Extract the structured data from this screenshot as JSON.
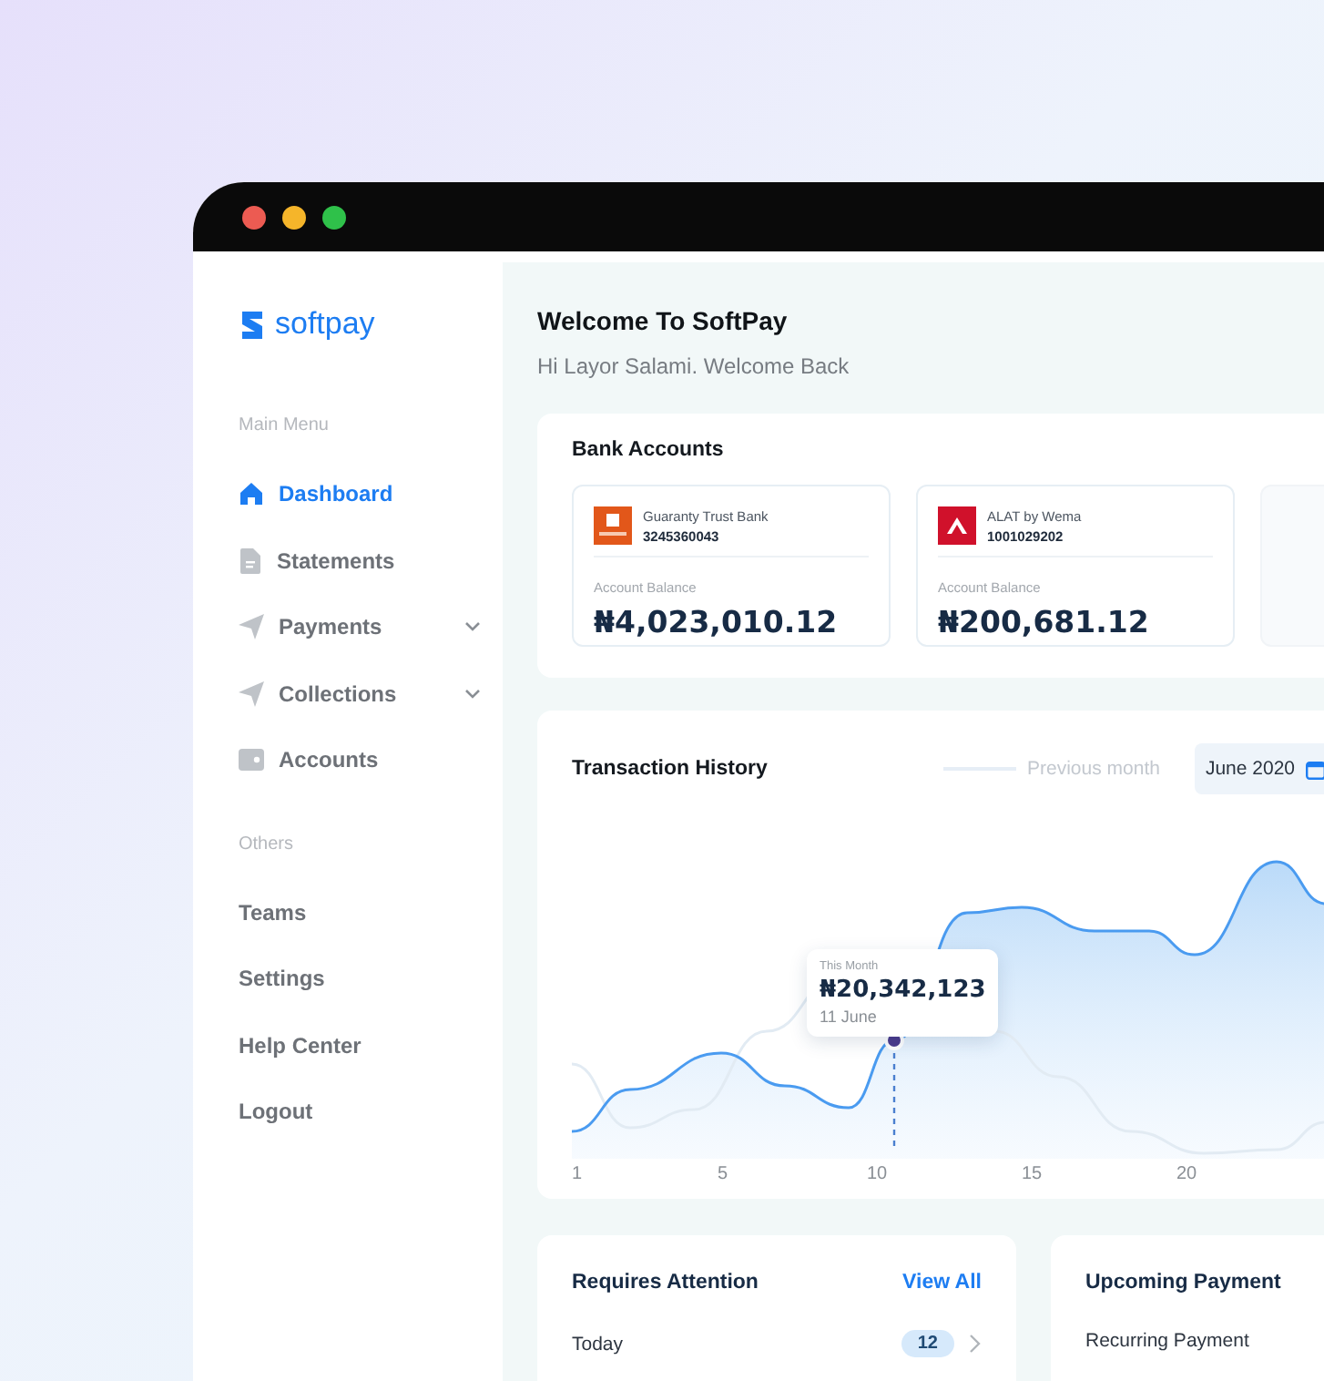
{
  "window": {
    "controls": [
      {
        "color": "#ec5b52"
      },
      {
        "color": "#f5b52a"
      },
      {
        "color": "#2fc14a"
      }
    ]
  },
  "sidebar": {
    "logo": "softpay",
    "sections": [
      {
        "title": "Main Menu",
        "items": [
          {
            "label": "Dashboard",
            "selected": true,
            "expandable": false
          },
          {
            "label": "Statements",
            "selected": false,
            "expandable": false
          },
          {
            "label": "Payments",
            "selected": false,
            "expandable": true
          },
          {
            "label": "Collections",
            "selected": false,
            "expandable": true
          },
          {
            "label": "Accounts",
            "selected": false,
            "expandable": false
          }
        ]
      },
      {
        "title": "Others",
        "items": [
          {
            "label": "Teams",
            "selected": false,
            "expandable": false
          },
          {
            "label": "Settings",
            "selected": false,
            "expandable": false
          },
          {
            "label": "Help Center",
            "selected": false,
            "expandable": false
          },
          {
            "label": "Logout",
            "selected": false,
            "expandable": false
          }
        ]
      }
    ]
  },
  "header": {
    "title": "Welcome To SoftPay",
    "subtitle": "Hi Layor Salami. Welcome Back"
  },
  "bank_accounts": {
    "title": "Bank Accounts",
    "accounts": [
      {
        "bank": "Guaranty Trust Bank",
        "number": "3245360043",
        "balance_label": "Account Balance",
        "balance": "₦4,023,010.12"
      },
      {
        "bank": "ALAT by Wema",
        "number": "1001029202",
        "balance_label": "Account Balance",
        "balance": "₦200,681.12"
      }
    ]
  },
  "transaction_history": {
    "title": "Transaction History",
    "legend": "Previous month",
    "date": "June 2020",
    "x_labels": [
      "1",
      "5",
      "10",
      "15",
      "20"
    ],
    "tooltip": {
      "label": "This Month",
      "value": "₦20,342,123",
      "date": "11 June"
    }
  },
  "requires_attention": {
    "title": "Requires Attention",
    "link": "View All",
    "rows": [
      {
        "label": "Today",
        "count": "12"
      }
    ]
  },
  "upcoming_payment": {
    "title": "Upcoming Payment",
    "rows": [
      {
        "label": "Recurring Payment"
      }
    ]
  }
}
